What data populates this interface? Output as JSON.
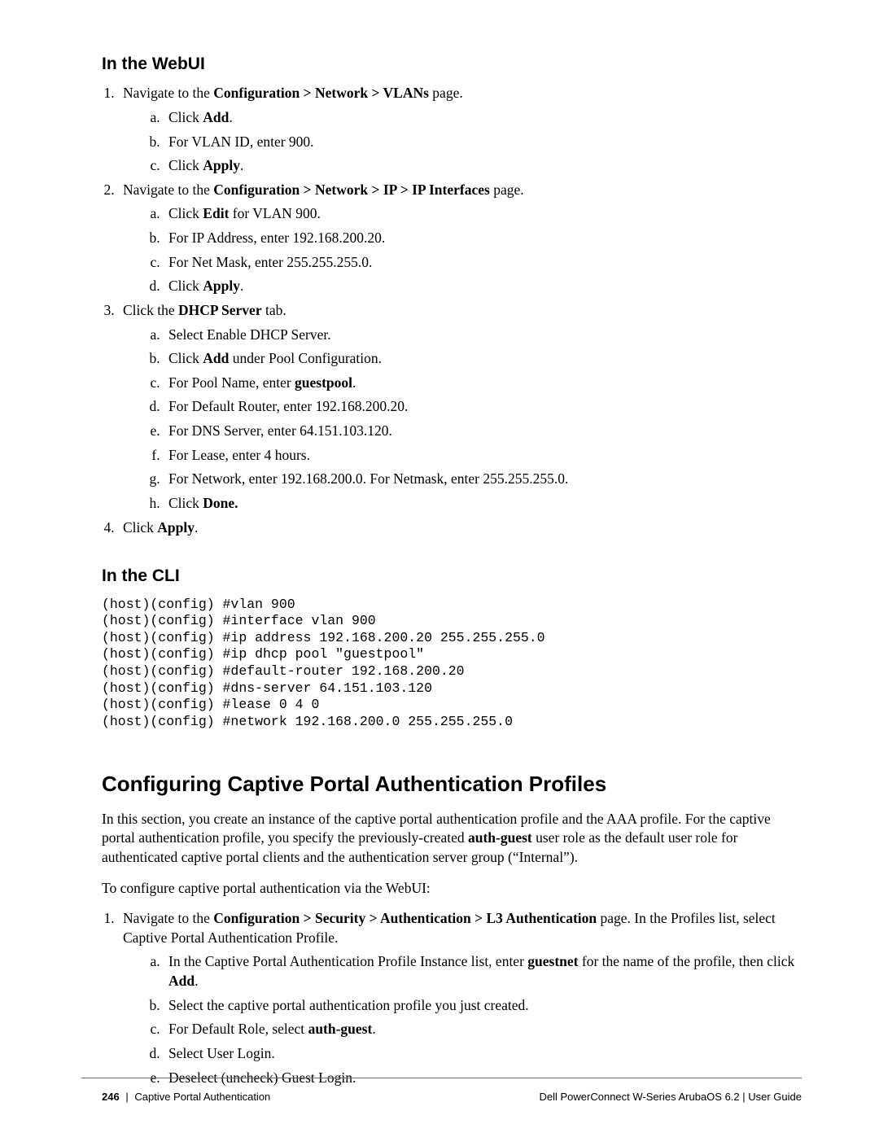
{
  "sec1": {
    "heading": "In the WebUI",
    "s1_pre": "Navigate to the ",
    "s1_b1": "Configuration > Network > VLANs",
    "s1_post": " page.",
    "s1a_pre": "Click ",
    "s1a_b": "Add",
    "s1a_post": ".",
    "s1b": "For VLAN ID, enter 900.",
    "s1c_pre": "Click ",
    "s1c_b": "Apply",
    "s1c_post": ".",
    "s2_pre": "Navigate to the ",
    "s2_b1": "Configuration > Network > IP > IP Interfaces",
    "s2_post": " page.",
    "s2a_pre": "Click ",
    "s2a_b": "Edit",
    "s2a_post": " for VLAN 900.",
    "s2b": "For IP Address, enter 192.168.200.20.",
    "s2c": "For Net Mask, enter 255.255.255.0.",
    "s2d_pre": "Click ",
    "s2d_b": "Apply",
    "s2d_post": ".",
    "s3_pre": "Click the ",
    "s3_b": "DHCP Server",
    "s3_post": " tab.",
    "s3a": "Select Enable DHCP Server.",
    "s3b_pre": "Click ",
    "s3b_b": "Add",
    "s3b_post": " under Pool Configuration.",
    "s3c_pre": "For Pool Name, enter ",
    "s3c_b": "guestpool",
    "s3c_post": ".",
    "s3d": "For Default Router, enter 192.168.200.20.",
    "s3e": "For DNS Server, enter 64.151.103.120.",
    "s3f": "For Lease, enter 4 hours.",
    "s3g": "For Network, enter 192.168.200.0. For Netmask, enter 255.255.255.0.",
    "s3h_pre": "Click ",
    "s3h_b": "Done.",
    "s4_pre": "Click ",
    "s4_b": "Apply",
    "s4_post": "."
  },
  "sec2": {
    "heading": "In the CLI",
    "code": "(host)(config) #vlan 900\n(host)(config) #interface vlan 900\n(host)(config) #ip address 192.168.200.20 255.255.255.0\n(host)(config) #ip dhcp pool \"guestpool\"\n(host)(config) #default-router 192.168.200.20\n(host)(config) #dns-server 64.151.103.120\n(host)(config) #lease 0 4 0\n(host)(config) #network 192.168.200.0 255.255.255.0"
  },
  "sec3": {
    "heading": "Configuring Captive Portal Authentication Profiles",
    "p1a": "In this section, you create an instance of the captive portal authentication profile and the AAA profile. For the captive portal authentication profile, you specify the previously-created ",
    "p1b": "auth-guest",
    "p1c": " user role as the default user role for authenticated captive portal clients and the authentication server group (“Internal”).",
    "p2": "To configure captive portal authentication via the WebUI:",
    "s1_pre": "Navigate to the ",
    "s1_b": "Configuration > Security > Authentication > L3 Authentication",
    "s1_post": " page. In the Profiles list, select Captive Portal Authentication Profile.",
    "s1a_pre": "In the Captive Portal Authentication Profile Instance list, enter ",
    "s1a_b1": "guestnet",
    "s1a_mid": " for the name of the profile, then click ",
    "s1a_b2": "Add",
    "s1a_post": ".",
    "s1b": "Select the captive portal authentication profile you just created.",
    "s1c_pre": "For Default Role, select ",
    "s1c_b": "auth-guest",
    "s1c_post": ".",
    "s1d": "Select User Login.",
    "s1e": "Deselect (uncheck) Guest Login."
  },
  "footer": {
    "pageNum": "246",
    "sep": "|",
    "section": "Captive Portal Authentication",
    "right": "Dell PowerConnect W-Series ArubaOS 6.2  |  User Guide"
  }
}
